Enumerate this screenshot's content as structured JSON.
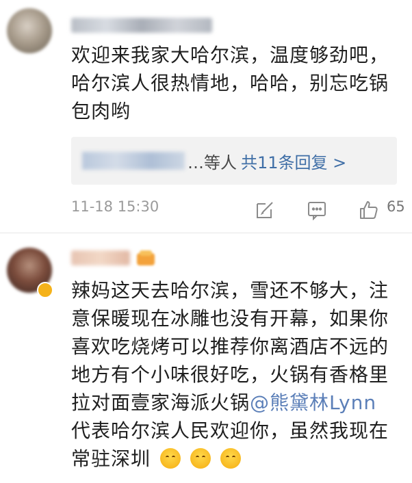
{
  "comments": [
    {
      "text_lines": [
        "欢迎来我家大哈尔滨，温度够劲吧，",
        "哈尔滨人很热情地，哈哈，别忘吃锅",
        "包肉哟"
      ],
      "reply": {
        "others": "…等人",
        "link": "共11条回复 >"
      },
      "time": "11-18 15:30",
      "likes": "65"
    },
    {
      "text_lines": [
        "辣妈这天去哈尔滨，雪还不够大，注",
        "意保暖现在冰雕也没有开幕，如果你",
        "喜欢吃烧烤可以推荐你离酒店不远的",
        "地方有个小味很好吃，火锅有香格里",
        "拉对面壹家海派火锅"
      ],
      "mention": "@熊黛林Lynn",
      "text_lines_after": [
        "代表哈尔滨人民欢迎你，虽然我现在",
        "常驻深圳"
      ]
    }
  ],
  "icons": {
    "edit": "edit-icon",
    "comment": "comment-icon",
    "like": "like-icon",
    "emoji": "blushing-emoji"
  },
  "colors": {
    "link": "#3f6ea6",
    "mention": "#5b7fb8",
    "meta": "#9a9a9a"
  }
}
